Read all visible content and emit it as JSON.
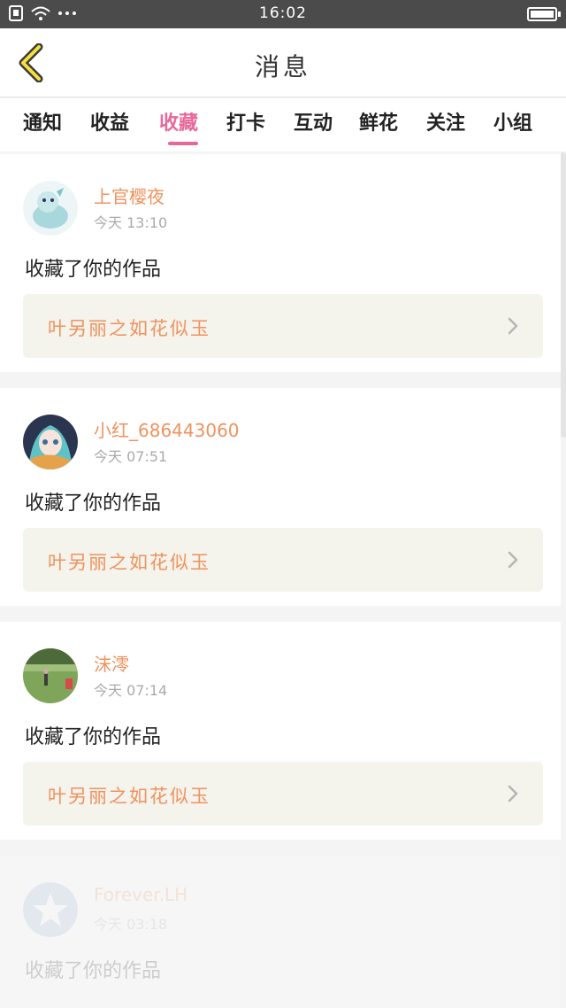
{
  "status_bar": {
    "time": "16:02"
  },
  "header": {
    "title": "消息"
  },
  "tabs": [
    {
      "label": "通知"
    },
    {
      "label": "收益"
    },
    {
      "label": "收藏"
    },
    {
      "label": "打卡"
    },
    {
      "label": "互动"
    },
    {
      "label": "鲜花"
    },
    {
      "label": "关注"
    },
    {
      "label": "小组"
    }
  ],
  "active_tab": "收藏",
  "accent_color": "#e8679a",
  "name_color": "#f0925e",
  "messages": [
    {
      "username": "上官樱夜",
      "time": "今天 13:10",
      "action": "收藏了你的作品",
      "work_title": "叶另丽之如花似玉",
      "avatar": "anime-creature-avatar"
    },
    {
      "username": "小红_686443060",
      "time": "今天 07:51",
      "action": "收藏了你的作品",
      "work_title": "叶另丽之如花似玉",
      "avatar": "anime-girl-avatar"
    },
    {
      "username": "沫澪",
      "time": "今天 07:14",
      "action": "收藏了你的作品",
      "work_title": "叶另丽之如花似玉",
      "avatar": "park-photo-avatar"
    },
    {
      "username": "Forever.LH",
      "time": "今天 03:18",
      "action": "收藏了你的作品",
      "avatar": "star-default-avatar"
    }
  ]
}
